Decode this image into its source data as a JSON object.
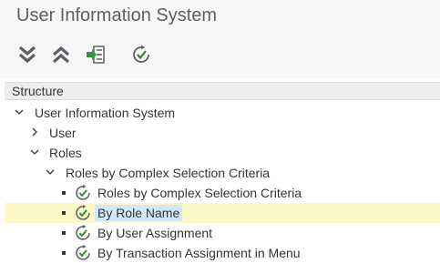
{
  "window": {
    "title": "User Information System"
  },
  "toolbar": {
    "buttons": [
      {
        "name": "expand-all",
        "icon": "double-chevron-down-icon"
      },
      {
        "name": "collapse-all",
        "icon": "double-chevron-up-icon"
      },
      {
        "name": "expand-subtree",
        "icon": "expand-subtree-icon"
      },
      {
        "name": "execute",
        "icon": "clock-check-icon"
      }
    ]
  },
  "structure": {
    "header": "Structure",
    "nodes": [
      {
        "label": "User Information System",
        "level": 0,
        "type": "folder",
        "expanded": true
      },
      {
        "label": "User",
        "level": 1,
        "type": "folder",
        "expanded": false
      },
      {
        "label": "Roles",
        "level": 1,
        "type": "folder",
        "expanded": true
      },
      {
        "label": "Roles by Complex Selection Criteria",
        "level": 2,
        "type": "folder",
        "expanded": true
      },
      {
        "label": "Roles by Complex Selection Criteria",
        "level": 3,
        "type": "report"
      },
      {
        "label": "By Role Name",
        "level": 3,
        "type": "report",
        "selected": true
      },
      {
        "label": "By User Assignment",
        "level": 3,
        "type": "report"
      },
      {
        "label": "By Transaction Assignment in Menu",
        "level": 3,
        "type": "report"
      }
    ]
  },
  "colors": {
    "toolbar_bg": "#f7f7f7",
    "header_bg": "#ededed",
    "selected_row_bg": "#fdf9c6",
    "selected_label_bg": "#d1e8fa",
    "icon_green": "#2b7d2b",
    "icon_gray": "#5a6066"
  }
}
